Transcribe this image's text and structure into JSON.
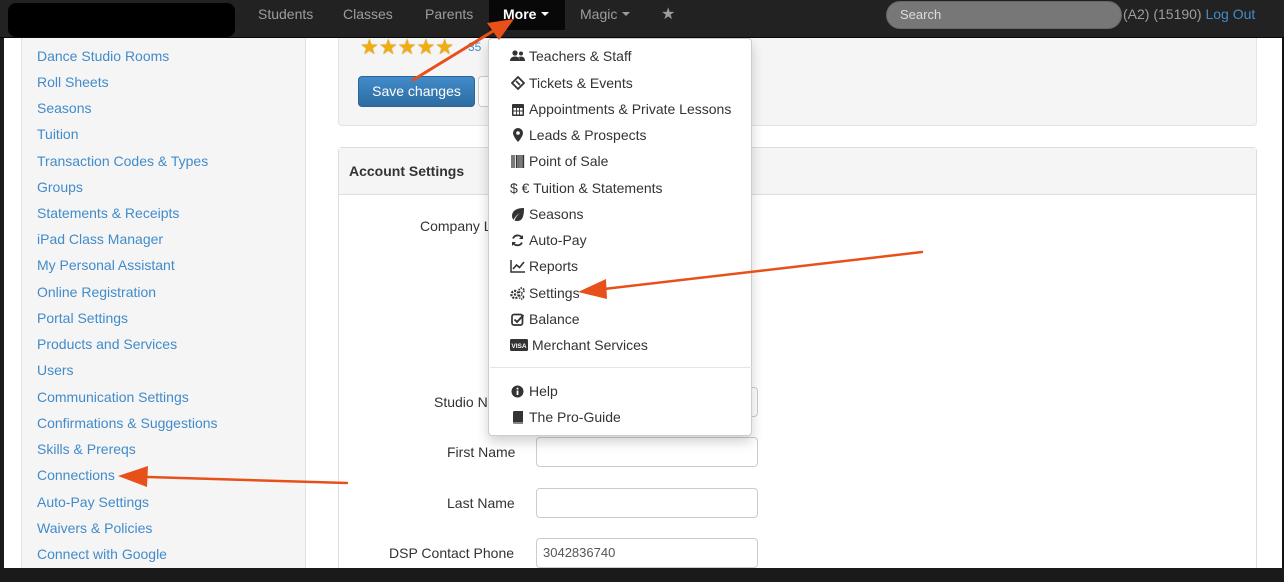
{
  "navbar": {
    "items": [
      {
        "label": "Students"
      },
      {
        "label": "Classes"
      },
      {
        "label": "Parents"
      },
      {
        "label": "More"
      },
      {
        "label": "Magic"
      }
    ],
    "star_glyph": "★",
    "search_placeholder": "Search",
    "user_info": "(A2) (15190)",
    "logout_label": "Log Out"
  },
  "sidebar": {
    "items": [
      {
        "label": "Dance Studio Rooms"
      },
      {
        "label": "Roll Sheets"
      },
      {
        "label": "Seasons"
      },
      {
        "label": "Tuition"
      },
      {
        "label": "Transaction Codes & Types"
      },
      {
        "label": "Groups"
      },
      {
        "label": "Statements & Receipts"
      },
      {
        "label": "iPad Class Manager"
      },
      {
        "label": "My Personal Assistant"
      },
      {
        "label": "Online Registration"
      },
      {
        "label": "Portal Settings"
      },
      {
        "label": "Products and Services"
      },
      {
        "label": "Users"
      },
      {
        "label": "Communication Settings"
      },
      {
        "label": "Confirmations & Suggestions"
      },
      {
        "label": "Skills & Prereqs"
      },
      {
        "label": "Connections"
      },
      {
        "label": "Auto-Pay Settings"
      },
      {
        "label": "Waivers & Policies"
      },
      {
        "label": "Connect with Google"
      }
    ]
  },
  "top_well": {
    "rating": 5,
    "rating_max": 5,
    "stars_text": "★★★★★",
    "review_count": "35",
    "save_label": "Save changes"
  },
  "account_settings": {
    "heading": "Account Settings",
    "fields": [
      {
        "label": "Company L",
        "value": ""
      },
      {
        "label": "Studio N",
        "value": ""
      },
      {
        "label": "First Name",
        "value": ""
      },
      {
        "label": "Last Name",
        "value": ""
      },
      {
        "label": "DSP Contact Phone",
        "value": "3042836740"
      }
    ]
  },
  "more_menu": {
    "items": [
      {
        "label": "Teachers & Staff",
        "icon": "users-icon"
      },
      {
        "label": "Tickets & Events",
        "icon": "ticket-icon"
      },
      {
        "label": "Appointments & Private Lessons",
        "icon": "calendar-icon"
      },
      {
        "label": "Leads & Prospects",
        "icon": "map-marker-icon"
      },
      {
        "label": "Point of Sale",
        "icon": "barcode-icon"
      },
      {
        "label": "$ € Tuition & Statements",
        "icon": "currency-icon"
      },
      {
        "label": "Seasons",
        "icon": "leaf-icon"
      },
      {
        "label": "Auto-Pay",
        "icon": "refresh-icon"
      },
      {
        "label": "Reports",
        "icon": "line-chart-icon"
      },
      {
        "label": "Settings",
        "icon": "cogs-icon"
      },
      {
        "label": "Balance",
        "icon": "check-square-icon"
      },
      {
        "label": "Merchant Services",
        "icon": "visa-card-icon"
      }
    ],
    "secondary_items": [
      {
        "label": "Help",
        "icon": "info-circle-icon"
      },
      {
        "label": "The Pro-Guide",
        "icon": "book-icon"
      }
    ]
  },
  "colors": {
    "navbar_bg": "#222222",
    "link": "#428bca",
    "primary_button": "#428bca",
    "annotation_arrow": "#e8501a",
    "stars": "#f0ad10"
  }
}
